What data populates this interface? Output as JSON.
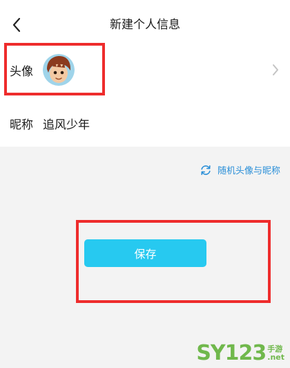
{
  "header": {
    "title": "新建个人信息",
    "back_icon": "chevron-left-icon"
  },
  "profile": {
    "avatar_label": "头像",
    "avatar_icon": "avatar-image",
    "chevron_icon": "chevron-right-icon",
    "nickname_label": "昵称",
    "nickname_value": "追风少年"
  },
  "random": {
    "label": "随机头像与昵称",
    "icon": "refresh-icon",
    "color": "#2a8fd8"
  },
  "actions": {
    "save_label": "保存",
    "save_color": "#27c9f0"
  },
  "annotations": {
    "highlight_color": "#ee2c2c"
  },
  "watermark": {
    "main": "SY123",
    "side_top": "手游",
    "side_bottom": ".net"
  }
}
